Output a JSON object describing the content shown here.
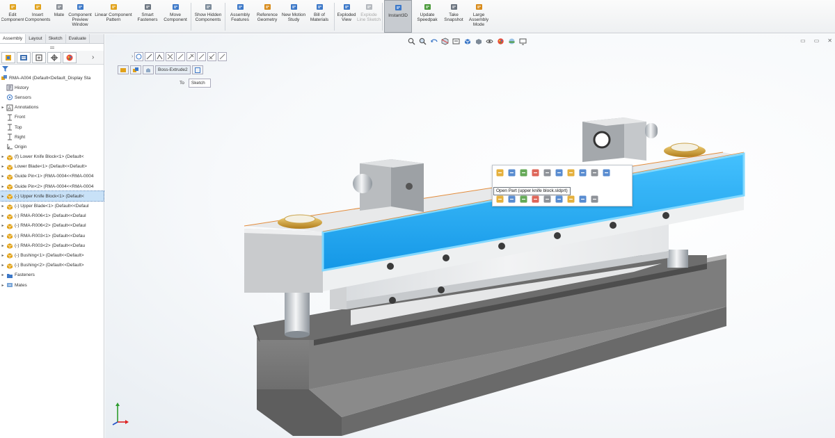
{
  "ribbon": {
    "buttons": [
      {
        "label": "Edit Component",
        "icon": "edit-component-icon",
        "color": "#e1a21b"
      },
      {
        "label": "Insert Components",
        "icon": "insert-components-icon",
        "color": "#e1a21b"
      },
      {
        "label": "Mate",
        "icon": "mate-icon",
        "color": "#8a8f96"
      },
      {
        "label": "Component Preview Window",
        "icon": "preview-window-icon",
        "color": "#3c78c8"
      },
      {
        "label": "Linear Component Pattern",
        "icon": "linear-pattern-icon",
        "color": "#e1a21b"
      },
      {
        "label": "Smart Fasteners",
        "icon": "smart-fasteners-icon",
        "color": "#6c7580"
      },
      {
        "label": "Move Component",
        "icon": "move-component-icon",
        "color": "#3c78c8"
      },
      {
        "label": "Show Hidden Components",
        "icon": "show-hidden-icon",
        "color": "#7b8a99"
      },
      {
        "label": "Assembly Features",
        "icon": "assembly-features-icon",
        "color": "#3c78c8"
      },
      {
        "label": "Reference Geometry",
        "icon": "reference-geometry-icon",
        "color": "#d88b1b"
      },
      {
        "label": "New Motion Study",
        "icon": "motion-study-icon",
        "color": "#3c78c8"
      },
      {
        "label": "Bill of Materials",
        "icon": "bill-of-materials-icon",
        "color": "#3c78c8"
      },
      {
        "label": "Exploded View",
        "icon": "exploded-view-icon",
        "color": "#3c78c8"
      },
      {
        "label": "Explode Line Sketch",
        "icon": "explode-line-sketch-icon",
        "color": "#b5b9be"
      },
      {
        "label": "Instant3D",
        "icon": "instant3d-icon",
        "color": "#3c78c8"
      },
      {
        "label": "Update Speedpak",
        "icon": "speedpak-icon",
        "color": "#4a9a3a"
      },
      {
        "label": "Take Snapshot",
        "icon": "snapshot-icon",
        "color": "#6c7580"
      },
      {
        "label": "Large Assembly Mode",
        "icon": "large-assembly-icon",
        "color": "#d88b1b"
      }
    ]
  },
  "feature_manager": {
    "tabs": [
      "Assembly",
      "Layout",
      "Sketch",
      "Evaluate"
    ],
    "active_tab": "Assembly",
    "root_label": "RMA-A004 (Default<Default_Display Sta",
    "items": [
      {
        "label": "History",
        "icon": "history-icon",
        "expand": ""
      },
      {
        "label": "Sensors",
        "icon": "sensors-icon",
        "expand": ""
      },
      {
        "label": "Annotations",
        "icon": "annotations-icon",
        "expand": "▸"
      },
      {
        "label": "Front",
        "icon": "plane-icon",
        "expand": ""
      },
      {
        "label": "Top",
        "icon": "plane-icon",
        "expand": ""
      },
      {
        "label": "Right",
        "icon": "plane-icon",
        "expand": ""
      },
      {
        "label": "Origin",
        "icon": "origin-icon",
        "expand": ""
      },
      {
        "label": "(f) Lower Knife Block<1> (Default<",
        "icon": "part-icon",
        "expand": "▸"
      },
      {
        "label": "Lower Blade<1> (Default<<Default>",
        "icon": "part-icon",
        "expand": "▸"
      },
      {
        "label": "Guide Pin<1> (RMA-0004<<RMA-0004",
        "icon": "part-icon",
        "expand": "▸"
      },
      {
        "label": "Guide Pin<2> (RMA-0004<<RMA-0004",
        "icon": "part-icon",
        "expand": "▸"
      },
      {
        "label": "(-) Upper Knife Block<1> (Default<",
        "icon": "part-icon",
        "expand": "▸",
        "selected": true
      },
      {
        "label": "(-) Upper Blade<1> (Default<<Defaul",
        "icon": "part-icon",
        "expand": "▸"
      },
      {
        "label": "(-) RMA-R006<1> (Default<<Defaul",
        "icon": "part-icon",
        "expand": "▸"
      },
      {
        "label": "(-) RMA-R006<2> (Default<<Defaul",
        "icon": "part-icon",
        "expand": "▸"
      },
      {
        "label": "(-) RMA-R003<1> (Default<<Defau",
        "icon": "part-icon",
        "expand": "▸"
      },
      {
        "label": "(-) RMA-R003<2> (Default<<Defau",
        "icon": "part-icon",
        "expand": "▸"
      },
      {
        "label": "(-) Bushing<1> (Default<<Default>",
        "icon": "part-icon",
        "expand": "▸"
      },
      {
        "label": "(-) Bushing<2> (Default<<Default>",
        "icon": "part-icon",
        "expand": "▸"
      },
      {
        "label": "Fasteners",
        "icon": "folder-icon",
        "expand": "▸"
      },
      {
        "label": "Mates",
        "icon": "mates-icon",
        "expand": "▸"
      }
    ]
  },
  "viewport": {
    "property_tab_label": "Boss-Extrude2",
    "to_label": "To",
    "to_value": "Sketch",
    "tooltip": "Open Part (upper knife block.sldprt)",
    "window_controls": [
      "▭",
      "▭",
      "✕"
    ]
  },
  "colors": {
    "selection_highlight": "#18a8f0",
    "part_gray": "#8d8d8d",
    "face_light": "#eceeef",
    "accent": "#e1a21b"
  }
}
